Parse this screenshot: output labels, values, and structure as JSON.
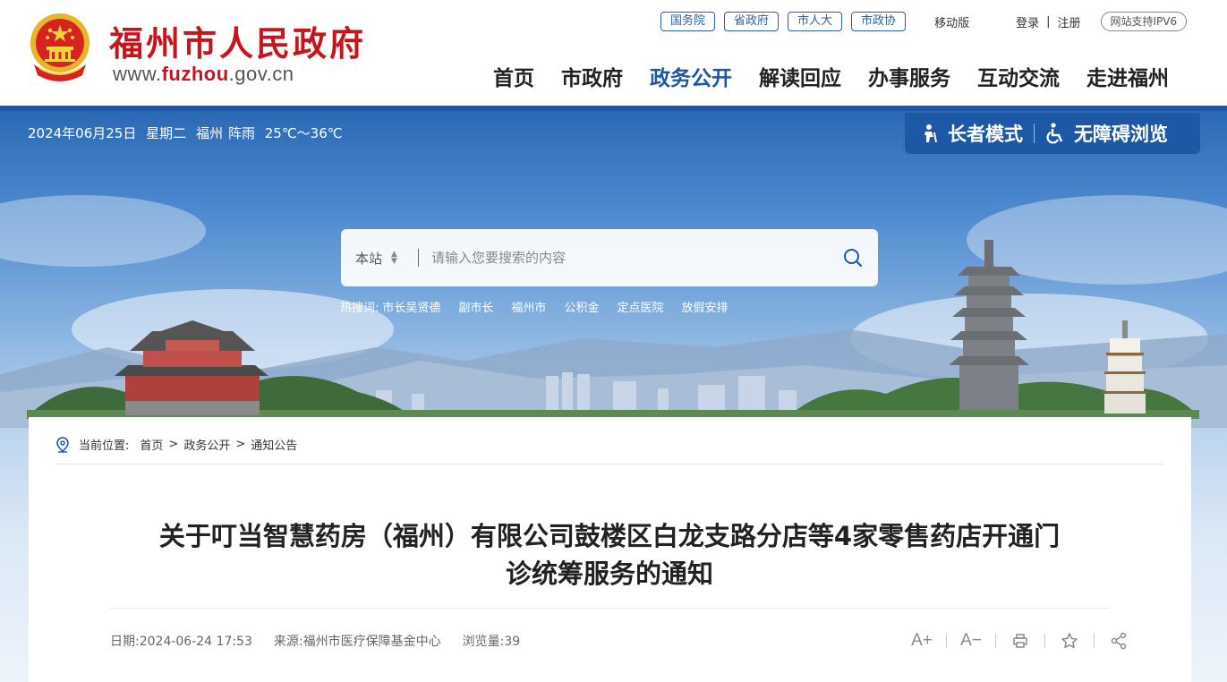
{
  "header": {
    "site_title": "福州市人民政府",
    "url_prefix": "www.",
    "url_highlight": "fuzhou",
    "url_suffix": ".gov.cn",
    "top_links": [
      "国务院",
      "省政府",
      "市人大",
      "市政协"
    ],
    "mobile_label": "移动版",
    "login_label": "登录",
    "register_label": "注册",
    "ipv6_label": "网站支持IPV6",
    "nav": [
      {
        "label": "首页"
      },
      {
        "label": "市政府"
      },
      {
        "label": "政务公开",
        "active": true
      },
      {
        "label": "解读回应"
      },
      {
        "label": "办事服务"
      },
      {
        "label": "互动交流"
      },
      {
        "label": "走进福州"
      }
    ]
  },
  "banner": {
    "date": "2024年06月25日",
    "weekday": "星期二",
    "city": "福州",
    "weather": "阵雨",
    "temp": "25℃～36℃",
    "elder_mode_label": "长者模式",
    "accessible_label": "无障碍浏览"
  },
  "search": {
    "scope": "本站",
    "placeholder": "请输入您要搜索的内容",
    "hot_label": "热搜词:",
    "hot_words": [
      "市长吴贤德",
      "副市长",
      "福州市",
      "公积金",
      "定点医院",
      "放假安排"
    ]
  },
  "breadcrumb": {
    "prefix": "当前位置:",
    "items": [
      "首页",
      "政务公开",
      "通知公告"
    ]
  },
  "article": {
    "title_line1": "关于叮当智慧药房（福州）有限公司鼓楼区白龙支路分店等4家零售药店开通门",
    "title_line2": "诊统筹服务的通知",
    "date_label": "日期:",
    "date": "2024-06-24 17:53",
    "source_label": "来源:",
    "source": "福州市医疗保障基金中心",
    "views_label": "浏览量:",
    "views": "39"
  },
  "tools": {
    "font_increase": "A+",
    "font_decrease": "A−"
  },
  "colors": {
    "brand_red": "#c4161c",
    "brand_blue": "#1d58a4"
  }
}
